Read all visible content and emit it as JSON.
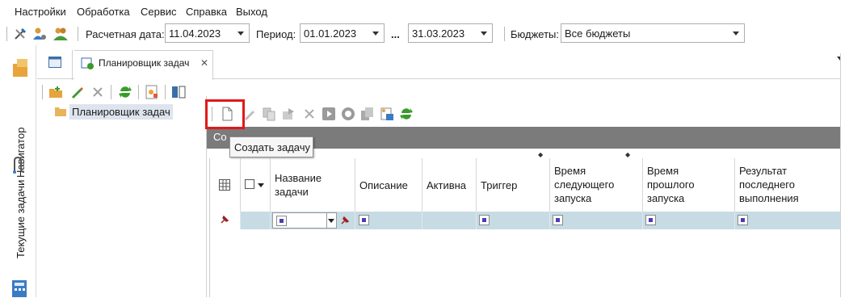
{
  "menu": [
    "Настройки",
    "Обработка",
    "Сервис",
    "Справка",
    "Выход"
  ],
  "toolbar": {
    "calc_date_label": "Расчетная дата:",
    "calc_date_value": "11.04.2023",
    "period_label": "Период:",
    "period_from": "01.01.2023",
    "period_dots": "...",
    "period_to": "31.03.2023",
    "budgets_label": "Бюджеты:",
    "budgets_value": "Все бюджеты"
  },
  "left_rail": {
    "navigator": "Навигатор",
    "current_tasks": "Текущие задачи"
  },
  "tabs": {
    "active_label": "Планировщик задач",
    "close_glyph": "✕"
  },
  "tree": {
    "root_label": "Планировщик задач"
  },
  "grey_bar_text": "Со",
  "tooltip": "Создать задачу",
  "grid": {
    "columns": [
      "Название\nзадачи",
      "Описание",
      "Активна",
      "Триггер",
      "Время\nследующего\nзапуска",
      "Время\nпрошлого\nзапуска",
      "Результат\nпоследнего\nвыполнения"
    ]
  },
  "colors": {
    "highlight": "#e21818",
    "filter_row": "#c7dbe4",
    "grey_bar": "#7b7b7b",
    "refresh_green": "#3a9a2a"
  }
}
